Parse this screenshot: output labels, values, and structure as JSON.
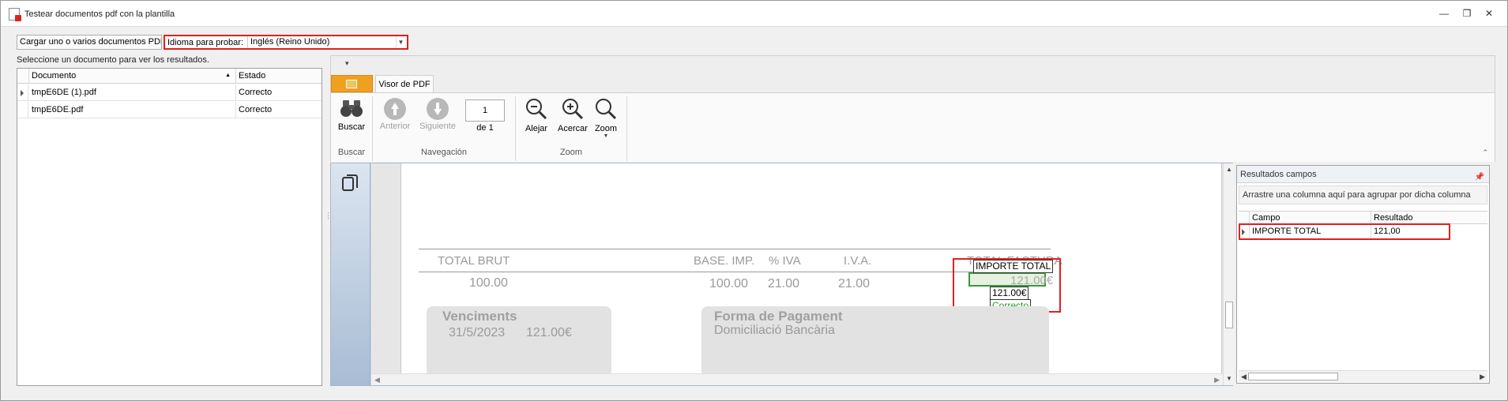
{
  "window": {
    "title": "Testear documentos pdf con la plantilla"
  },
  "window_controls": {
    "minimize": "—",
    "restore": "❐",
    "close": "✕"
  },
  "top_bar": {
    "load_button": "Cargar uno o varios documentos PDF",
    "language_label": "Idioma para probar:",
    "language_value": "Inglés (Reino Unido)"
  },
  "hint": "Seleccione un documento para ver los resultados.",
  "documents_grid": {
    "columns": [
      "Documento",
      "Estado"
    ],
    "rows": [
      {
        "documento": "tmpE6DE (1).pdf",
        "estado": "Correcto"
      },
      {
        "documento": "tmpE6DE.pdf",
        "estado": "Correcto"
      }
    ]
  },
  "ribbon": {
    "tab_file_icon": "document-icon",
    "tab_active": "Visor de PDF",
    "buscar": "Buscar",
    "anterior": "Anterior",
    "siguiente": "Siguiente",
    "page_number": "1",
    "page_of": "de 1",
    "alejar": "Alejar",
    "acercar": "Acercar",
    "zoom": "Zoom",
    "groups": {
      "buscar": "Buscar",
      "navegacion": "Navegación",
      "zoom": "Zoom"
    }
  },
  "pdf": {
    "headers": [
      "TOTAL BRUT",
      "BASE. IMP.",
      "% IVA",
      "I.V.A.",
      "TOTAL FACTURA"
    ],
    "values": [
      "100.00",
      "100.00",
      "21.00",
      "21.00",
      "121.00€"
    ],
    "vencimients_title": "Venciments",
    "vencimients_date": "31/5/2023",
    "vencimients_amount": "121.00€",
    "payment_title": "Forma de Pagament",
    "payment_method": "Domiciliació Bancària",
    "overlay_field": "IMPORTE TOTAL",
    "overlay_value": "121.00€",
    "overlay_status": "Correcto"
  },
  "results_panel": {
    "title": "Resultados campos",
    "groupby_hint": "Arrastre una columna aquí para agrupar por dicha columna",
    "columns": [
      "Campo",
      "Resultado"
    ],
    "rows": [
      {
        "campo": "IMPORTE TOTAL",
        "resultado": "121,00"
      }
    ]
  },
  "colors": {
    "highlight_red": "#e02020",
    "highlight_green": "#3a9a3a",
    "ok_text": "#2a9a2a",
    "file_tab": "#f0a020"
  }
}
